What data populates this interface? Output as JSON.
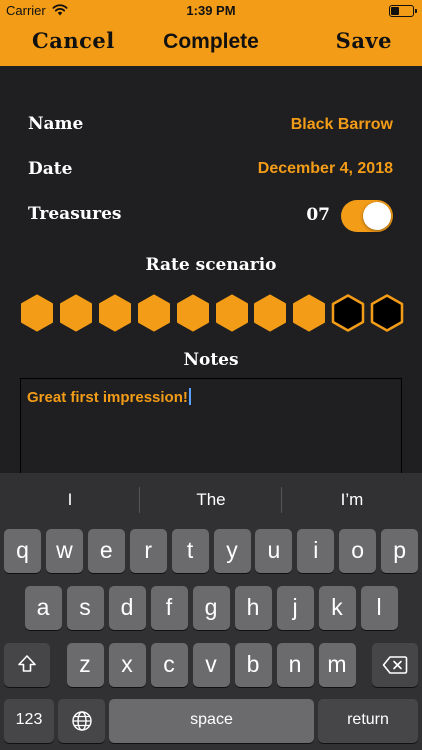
{
  "status_bar": {
    "carrier": "Carrier",
    "time": "1:39 PM"
  },
  "nav": {
    "cancel_label": "Cancel",
    "title": "Complete",
    "save_label": "Save"
  },
  "form": {
    "name_label": "Name",
    "name_value": "Black Barrow",
    "date_label": "Date",
    "date_value": "December 4, 2018",
    "treasures_label": "Treasures",
    "treasures_count": "07",
    "treasures_toggle_on": true
  },
  "rating": {
    "title": "Rate scenario",
    "value": 8,
    "max": 10
  },
  "notes": {
    "title": "Notes",
    "text": "Great first impression!"
  },
  "keyboard": {
    "suggestions": [
      "I",
      "The",
      "I’m"
    ],
    "row1": [
      "q",
      "w",
      "e",
      "r",
      "t",
      "y",
      "u",
      "i",
      "o",
      "p"
    ],
    "row2": [
      "a",
      "s",
      "d",
      "f",
      "g",
      "h",
      "j",
      "k",
      "l"
    ],
    "row3": [
      "z",
      "x",
      "c",
      "v",
      "b",
      "n",
      "m"
    ],
    "numbers_label": "123",
    "space_label": "space",
    "return_label": "return"
  },
  "colors": {
    "accent": "#f39c17",
    "background": "#1f1f21",
    "keyboard": "#313133",
    "key": "#6b6b6e",
    "key_dark": "#464648"
  }
}
